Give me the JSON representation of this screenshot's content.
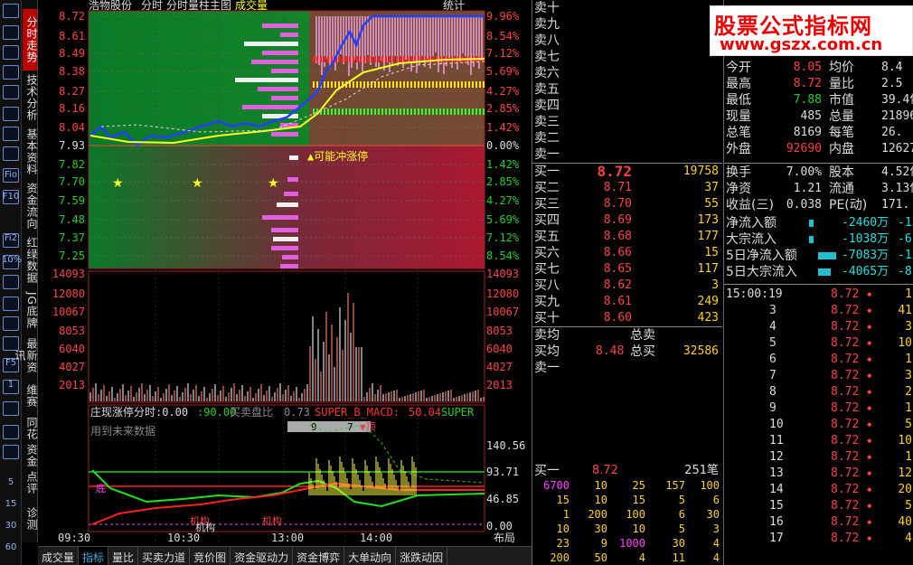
{
  "stock": {
    "name": "浩物股份",
    "mode1": "分时",
    "mode2": "分时量柱主图",
    "mode3": "成交量",
    "stats": "统计"
  },
  "left_nav": [
    {
      "label": "分时走势",
      "active": true
    },
    {
      "label": "技术分析"
    },
    {
      "label": "基本资料"
    },
    {
      "label": "资金流向"
    },
    {
      "label": "红绿数据"
    },
    {
      "label": "JG底牌"
    },
    {
      "label": "最新资讯"
    },
    {
      "label": "维赛"
    },
    {
      "label": "同花"
    },
    {
      "label": "资金"
    },
    {
      "label": "点评"
    },
    {
      "label": "诊测"
    }
  ],
  "left_icons": [
    "Fio",
    "F10",
    "Fi2",
    "10%",
    "F5",
    "1",
    "5",
    "15",
    "30",
    "60"
  ],
  "price_axis": {
    "left": [
      "8.72",
      "8.61",
      "8.49",
      "8.38",
      "8.27",
      "8.16",
      "8.04",
      "7.93",
      "7.82",
      "7.70",
      "7.59",
      "7.48",
      "7.37",
      "7.25"
    ],
    "right": [
      "9.96%",
      "8.54%",
      "7.12%",
      "5.69%",
      "4.27%",
      "2.85%",
      "1.42%",
      "0.00%",
      "1.42%",
      "2.85%",
      "4.27%",
      "5.69%",
      "7.12%",
      "8.54%"
    ]
  },
  "volume_axis": [
    "14093",
    "12080",
    "10067",
    "8053",
    "6040",
    "4027",
    "2013"
  ],
  "indicator": {
    "title": "庄现涨停分时",
    "v1": "0.00",
    "v2": "90.00",
    "ratio_label": "买卖盘比",
    "ratio": "0.73",
    "macd_label": "SUPER_B_MACD:",
    "macd_val": "50.04",
    "super": "SUPER",
    "future": "用到未来数据",
    "axis": [
      "140.56",
      "93.71",
      "46.85",
      "0.00"
    ],
    "box1": "9",
    "box2": "7",
    "tag_top": "顶",
    "tag_bottom": "底",
    "tag_jg": "机构"
  },
  "annot": "▲可能冲涨停",
  "time_axis": [
    "09:30",
    "10:30",
    "13:00",
    "14:00"
  ],
  "layout_label": "布局",
  "bottom_tabs": [
    "成交量",
    "指标",
    "量比",
    "买卖力道",
    "竞价图",
    "资金驱动力",
    "资金博弈",
    "大单动向",
    "涨跌动因"
  ],
  "asks": [
    "卖十",
    "卖九",
    "卖八",
    "卖七",
    "卖六",
    "卖五",
    "卖四",
    "卖三",
    "卖二",
    "卖一"
  ],
  "bids": [
    {
      "l": "买一",
      "p": "8.72",
      "v": "19758"
    },
    {
      "l": "买二",
      "p": "8.71",
      "v": "37"
    },
    {
      "l": "买三",
      "p": "8.70",
      "v": "55"
    },
    {
      "l": "买四",
      "p": "8.69",
      "v": "173"
    },
    {
      "l": "买五",
      "p": "8.68",
      "v": "177"
    },
    {
      "l": "买六",
      "p": "8.66",
      "v": "15"
    },
    {
      "l": "买七",
      "p": "8.65",
      "v": "117"
    },
    {
      "l": "买八",
      "p": "8.62",
      "v": "3"
    },
    {
      "l": "买九",
      "p": "8.61",
      "v": "249"
    },
    {
      "l": "买十",
      "p": "8.60",
      "v": "423"
    }
  ],
  "avg": {
    "ask_avg": "卖均",
    "bid_avg": "买均",
    "bid_avg_val": "8.48",
    "total_sell": "总卖",
    "total_buy": "总买",
    "total_buy_val": "32586",
    "sell1": "卖一"
  },
  "queue": {
    "label": "买一",
    "price": "8.72",
    "count": "251笔",
    "rows": [
      [
        "6700",
        "10",
        "25",
        "157",
        "100"
      ],
      [
        "15",
        "10",
        "15",
        "5",
        "6"
      ],
      [
        "1",
        "200",
        "100",
        "6",
        "30"
      ],
      [
        "10",
        "30",
        "10",
        "5",
        "3"
      ],
      [
        "23",
        "9",
        "1000",
        "30",
        "4"
      ],
      [
        "200",
        "50",
        "4",
        "11",
        "4"
      ]
    ]
  },
  "logo": {
    "line1": "股票公式指标网",
    "line2": "www.gszx.com.cn"
  },
  "stats": [
    {
      "k": "今开",
      "v": "8.05",
      "c": "#ff4040",
      "k2": "均价",
      "v2": "8.4"
    },
    {
      "k": "最高",
      "v": "8.72",
      "c": "#ff4040",
      "k2": "量比",
      "v2": "2.5"
    },
    {
      "k": "最低",
      "v": "7.88",
      "c": "#20d020",
      "k2": "市值",
      "v2": "39.4亿"
    },
    {
      "k": "现量",
      "v": "485",
      "c": "#ddd",
      "k2": "总量",
      "v2": "21896"
    },
    {
      "k": "总笔",
      "v": "8169",
      "c": "#ddd",
      "k2": "每笔",
      "v2": "26."
    },
    {
      "k": "外盘",
      "v": "92690",
      "c": "#ff4040",
      "k2": "内盘",
      "v2": "12627"
    }
  ],
  "stats2": [
    {
      "k": "换手",
      "v": "7.00%",
      "k2": "股本",
      "v2": "4.52亿"
    },
    {
      "k": "净资",
      "v": "1.21",
      "k2": "流通",
      "v2": "3.13亿"
    },
    {
      "k": "收益(三)",
      "v": "0.038",
      "k2": "PE(动)",
      "v2": "171."
    }
  ],
  "flows": [
    {
      "k": "净流入额",
      "v": "-2460万",
      "v2": "-13"
    },
    {
      "k": "大宗流入",
      "v": "-1038万",
      "v2": "-6"
    },
    {
      "k": "5日净流入额",
      "v": "-7083万",
      "v2": "-15"
    },
    {
      "k": "5日大宗流入",
      "v": "-4065万",
      "v2": "-8"
    }
  ],
  "ticks": [
    [
      "15:00:19",
      "8.72",
      "1"
    ],
    [
      "3",
      "8.72",
      "41"
    ],
    [
      "4",
      "8.72",
      "3"
    ],
    [
      "5",
      "8.72",
      "10"
    ],
    [
      "6",
      "8.72",
      "1"
    ],
    [
      "7",
      "8.72",
      "3"
    ],
    [
      "8",
      "8.72",
      "2"
    ],
    [
      "9",
      "8.72",
      "1"
    ],
    [
      "10",
      "8.72",
      "5"
    ],
    [
      "11",
      "8.72",
      "10"
    ],
    [
      "12",
      "8.72",
      "1"
    ],
    [
      "13",
      "8.72",
      "12"
    ],
    [
      "14",
      "8.72",
      "20"
    ],
    [
      "15",
      "8.72",
      "5"
    ],
    [
      "16",
      "8.72",
      "40"
    ],
    [
      "17",
      "8.72",
      "4"
    ]
  ]
}
